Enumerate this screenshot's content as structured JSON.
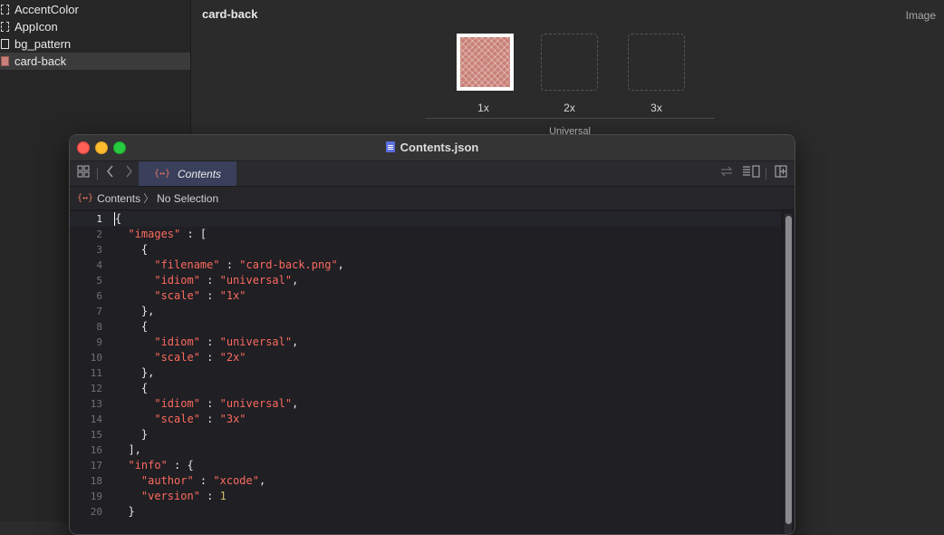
{
  "sidebar": {
    "items": [
      {
        "label": "AccentColor",
        "icon": "dashed-square-icon",
        "selected": false
      },
      {
        "label": "AppIcon",
        "icon": "dashed-square-icon",
        "selected": false
      },
      {
        "label": "bg_pattern",
        "icon": "square-icon",
        "selected": false
      },
      {
        "label": "card-back",
        "icon": "thumbnail-icon",
        "selected": true
      }
    ]
  },
  "asset_editor": {
    "title": "card-back",
    "inspector_label": "Image",
    "slots": [
      {
        "label": "1x",
        "filled": true
      },
      {
        "label": "2x",
        "filled": false
      },
      {
        "label": "3x",
        "filled": false
      }
    ],
    "group_label": "Universal"
  },
  "window": {
    "title": "Contents.json",
    "tab_label": "Contents",
    "tab_icon_glyph": "{↔}",
    "breadcrumb": {
      "file": "Contents",
      "selection": "No Selection",
      "icon_glyph": "{↔}"
    }
  },
  "code": {
    "lines": [
      {
        "n": "1",
        "text": "{"
      },
      {
        "n": "2",
        "text": "  \"images\" : ["
      },
      {
        "n": "3",
        "text": "    {"
      },
      {
        "n": "4",
        "text": "      \"filename\" : \"card-back.png\","
      },
      {
        "n": "5",
        "text": "      \"idiom\" : \"universal\","
      },
      {
        "n": "6",
        "text": "      \"scale\" : \"1x\""
      },
      {
        "n": "7",
        "text": "    },"
      },
      {
        "n": "8",
        "text": "    {"
      },
      {
        "n": "9",
        "text": "      \"idiom\" : \"universal\","
      },
      {
        "n": "10",
        "text": "      \"scale\" : \"2x\""
      },
      {
        "n": "11",
        "text": "    },"
      },
      {
        "n": "12",
        "text": "    {"
      },
      {
        "n": "13",
        "text": "      \"idiom\" : \"universal\","
      },
      {
        "n": "14",
        "text": "      \"scale\" : \"3x\""
      },
      {
        "n": "15",
        "text": "    }"
      },
      {
        "n": "16",
        "text": "  ],"
      },
      {
        "n": "17",
        "text": "  \"info\" : {"
      },
      {
        "n": "18",
        "text": "    \"author\" : \"xcode\","
      },
      {
        "n": "19",
        "text": "    \"version\" : 1"
      },
      {
        "n": "20",
        "text": "  }"
      }
    ],
    "current_line": "1"
  },
  "colors": {
    "string": "#fc6a5d",
    "number": "#d0bf69",
    "tab_bg": "#3a3f5c"
  }
}
